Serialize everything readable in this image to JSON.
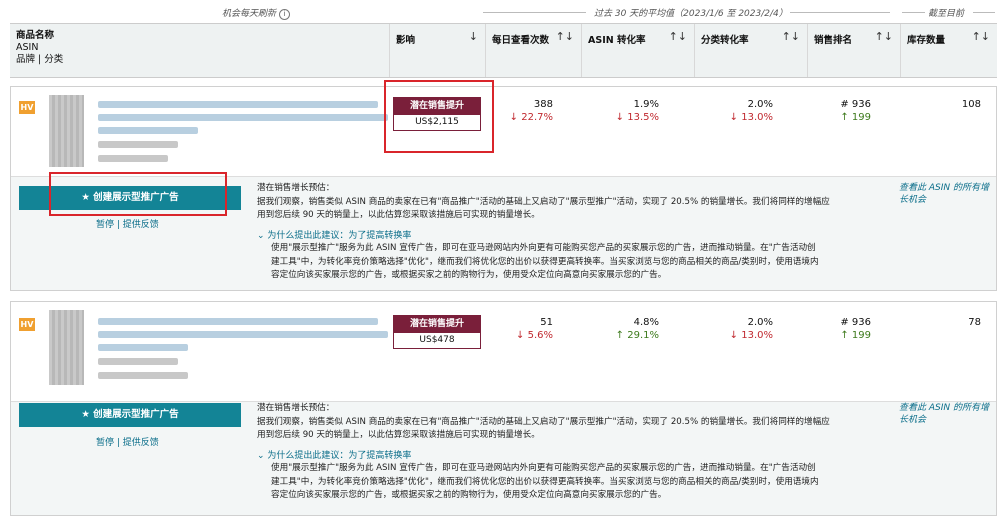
{
  "top_labels": {
    "refresh": "机会每天刷新",
    "avg": "过去 30 天的平均值（2023/1/6 至 2023/2/4）",
    "to_date": "截至目前"
  },
  "header": {
    "product": {
      "line1": "商品名称",
      "line2": "ASIN",
      "line3": "品牌 | 分类"
    },
    "impact": "影响",
    "columns": [
      "每日查看次数",
      "ASIN 转化率",
      "分类转化率",
      "销售排名",
      "库存数量"
    ]
  },
  "rows": [
    {
      "badge_tag": "HV",
      "impact_label": "潜在销售提升",
      "impact_value": "US$2,115",
      "views": "388",
      "views_change": "22.7%",
      "asin_cr": "1.9%",
      "asin_cr_change": "13.5%",
      "cat_cr": "2.0%",
      "cat_cr_change": "13.0%",
      "rank": "# 936",
      "rank_change": "199",
      "inventory": "108",
      "cta": "创建展示型推广广告",
      "pause": "暂停",
      "feedback": "提供反馈",
      "estimate_title": "潜在销售增长预估：",
      "estimate_text_1": "据我们观察，销售类似 ASIN 商品的卖家在已有\"商品推广\"活动的基础上又启动了\"展示型推广\"活动，实现了 20.5% 的销量增长。我们将同样的增幅应",
      "estimate_text_2": "用到您后续 90 天的销量上，以此估算您采取该措施后可实现的销量增长。",
      "why_title": "为什么提出此建议：为了提高转换率",
      "why_text_1": "使用\"展示型推广\"服务为此 ASIN 宣传广告，即可在亚马逊网站内外向更有可能购买您产品的买家展示您的广告，进而推动销量。在\"广告活动创",
      "why_text_2": "建工具\"中，为转化率竞价策略选择\"优化\"，继而我们将优化您的出价以获得更高转换率。当买家浏览与您的商品相关的商品/类别时，使用语境内",
      "why_text_3": "容定位向该买家展示您的广告，或根据买家之前的购物行为，使用受众定位向高意向买家展示您的广告。",
      "side_link": "查看此 ASIN 的所有增长机会"
    },
    {
      "badge_tag": "HV",
      "impact_label": "潜在销售提升",
      "impact_value": "US$478",
      "views": "51",
      "views_change": "5.6%",
      "asin_cr": "4.8%",
      "asin_cr_change": "29.1%",
      "cat_cr": "2.0%",
      "cat_cr_change": "13.0%",
      "rank": "# 936",
      "rank_change": "199",
      "inventory": "78",
      "cta": "创建展示型推广广告",
      "pause": "暂停",
      "feedback": "提供反馈",
      "estimate_title": "潜在销售增长预估：",
      "estimate_text_1": "据我们观察，销售类似 ASIN 商品的卖家在已有\"商品推广\"活动的基础上又启动了\"展示型推广\"活动，实现了 20.5% 的销量增长。我们将同样的增幅应",
      "estimate_text_2": "用到您后续 90 天的销量上，以此估算您采取该措施后可实现的销量增长。",
      "why_title": "为什么提出此建议：为了提高转换率",
      "why_text_1": "使用\"展示型推广\"服务为此 ASIN 宣传广告，即可在亚马逊网站内外向更有可能购买您产品的买家展示您的广告，进而推动销量。在\"广告活动创",
      "why_text_2": "建工具\"中，为转化率竞价策略选择\"优化\"，继而我们将优化您的出价以获得更高转换率。当买家浏览与您的商品相关的商品/类别时，使用语境内",
      "why_text_3": "容定位向该买家展示您的广告，或根据买家之前的购物行为，使用受众定位向高意向买家展示您的广告。",
      "side_link": "查看此 ASIN 的所有增长机会"
    }
  ],
  "colors": {
    "accent": "#138496",
    "impact": "#7a1f3a",
    "down": "#c0292f",
    "up": "#3d7a1c",
    "highlight": "#d9252b"
  }
}
